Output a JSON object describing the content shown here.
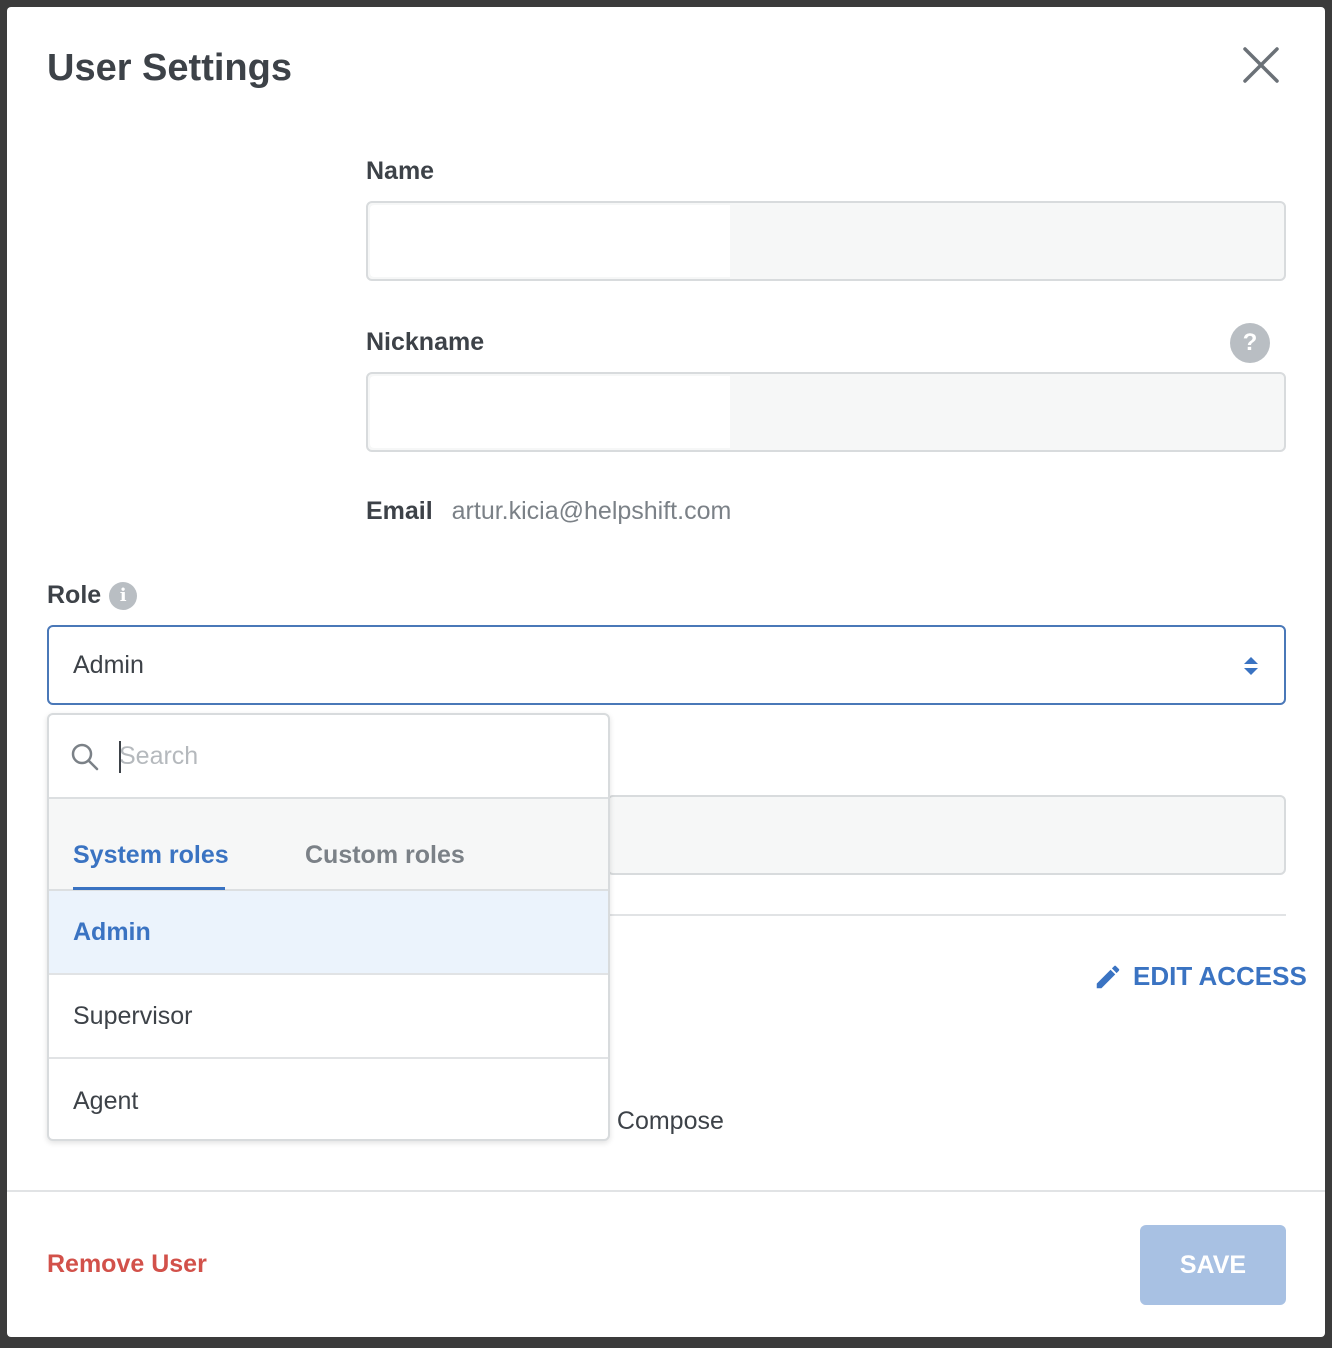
{
  "modal": {
    "title": "User Settings"
  },
  "form": {
    "name_label": "Name",
    "name_value": "",
    "nickname_label": "Nickname",
    "nickname_value": "",
    "help_icon_glyph": "?",
    "email_label": "Email",
    "email_value": "artur.kicia@helpshift.com",
    "role_label": "Role",
    "role_info_glyph": "i",
    "role_selected": "Admin"
  },
  "dropdown": {
    "search_placeholder": "Search",
    "tabs": [
      {
        "label": "System roles",
        "active": true
      },
      {
        "label": "Custom roles",
        "active": false
      }
    ],
    "options": [
      {
        "label": "Admin",
        "selected": true
      },
      {
        "label": "Supervisor",
        "selected": false
      },
      {
        "label": "Agent",
        "selected": false
      }
    ]
  },
  "background": {
    "edit_access_label": "EDIT ACCESS",
    "partial_text": "I Compose"
  },
  "footer": {
    "remove_user_label": "Remove User",
    "save_label": "SAVE"
  },
  "colors": {
    "accent": "#3a73c2",
    "danger": "#d2514a",
    "save_disabled": "#a8c1e3",
    "selected_option_bg": "#ebf3fc"
  },
  "icons": [
    "close-icon",
    "help-icon",
    "info-icon",
    "select-arrows-icon",
    "search-icon",
    "pencil-icon"
  ]
}
